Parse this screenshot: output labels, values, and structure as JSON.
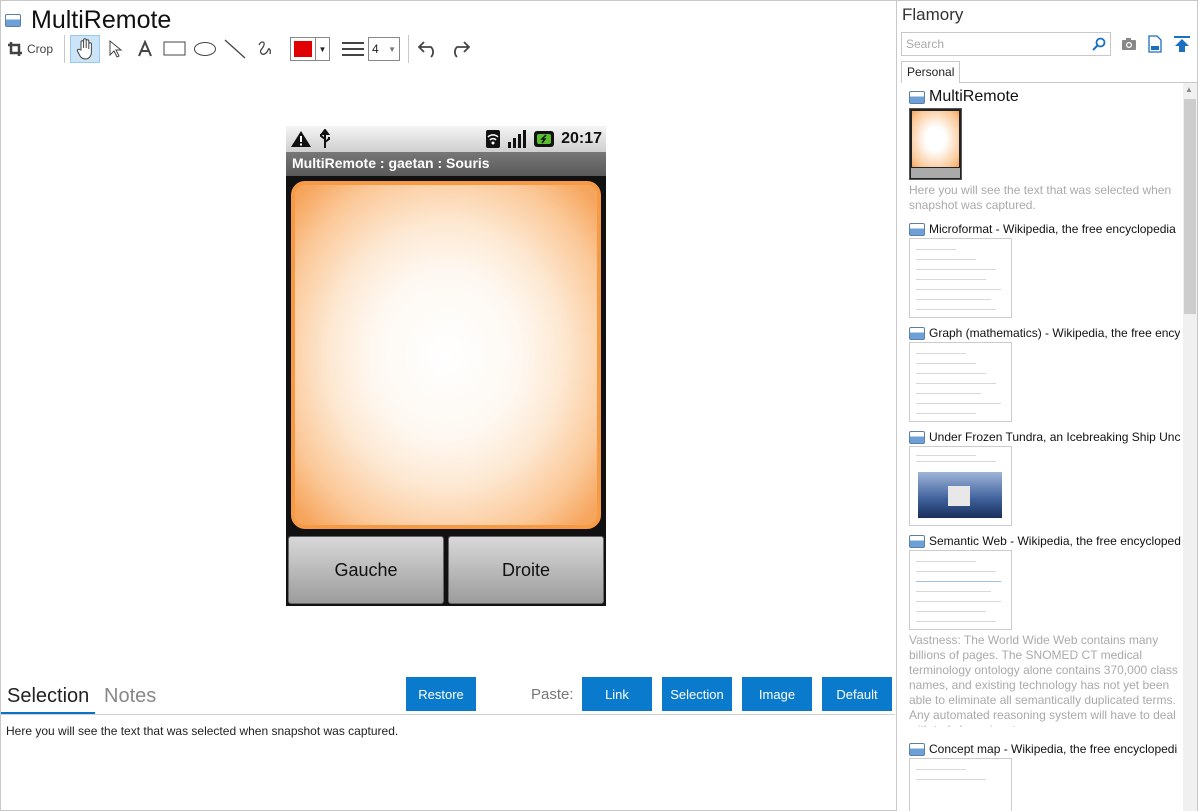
{
  "app": {
    "title": "MultiRemote"
  },
  "toolbar": {
    "crop_label": "Crop",
    "line_width": "4",
    "color": "#e00000"
  },
  "phone": {
    "time": "20:17",
    "title": "MultiRemote : gaetan : Souris",
    "left_button": "Gauche",
    "right_button": "Droite"
  },
  "bottom": {
    "tab_selection": "Selection",
    "tab_notes": "Notes",
    "restore": "Restore",
    "paste_label": "Paste:",
    "link": "Link",
    "selection": "Selection",
    "image": "Image",
    "default": "Default",
    "selection_text": "Here you will see the text that was selected when snapshot was captured."
  },
  "panel": {
    "title": "Flamory",
    "search_placeholder": "Search",
    "tab": "Personal",
    "items": [
      {
        "title": "MultiRemote",
        "desc": "Here you will see the text that was selected when snapshot was captured."
      },
      {
        "title": "Microformat - Wikipedia, the free encyclopedia"
      },
      {
        "title": "Graph (mathematics) - Wikipedia, the free ency"
      },
      {
        "title": "Under Frozen Tundra, an Icebreaking Ship Unco"
      },
      {
        "title": "Semantic Web - Wikipedia, the free encycloped",
        "desc": "Vastness: The World Wide Web contains many billions of pages. The SNOMED CT medical terminology ontology alone contains 370,000 class names, and existing technology has not yet been able to eliminate all semantically duplicated terms. Any automated reasoning system will have to deal with truly huge inputs."
      },
      {
        "title": "Concept map - Wikipedia, the free encyclopedi"
      }
    ]
  }
}
